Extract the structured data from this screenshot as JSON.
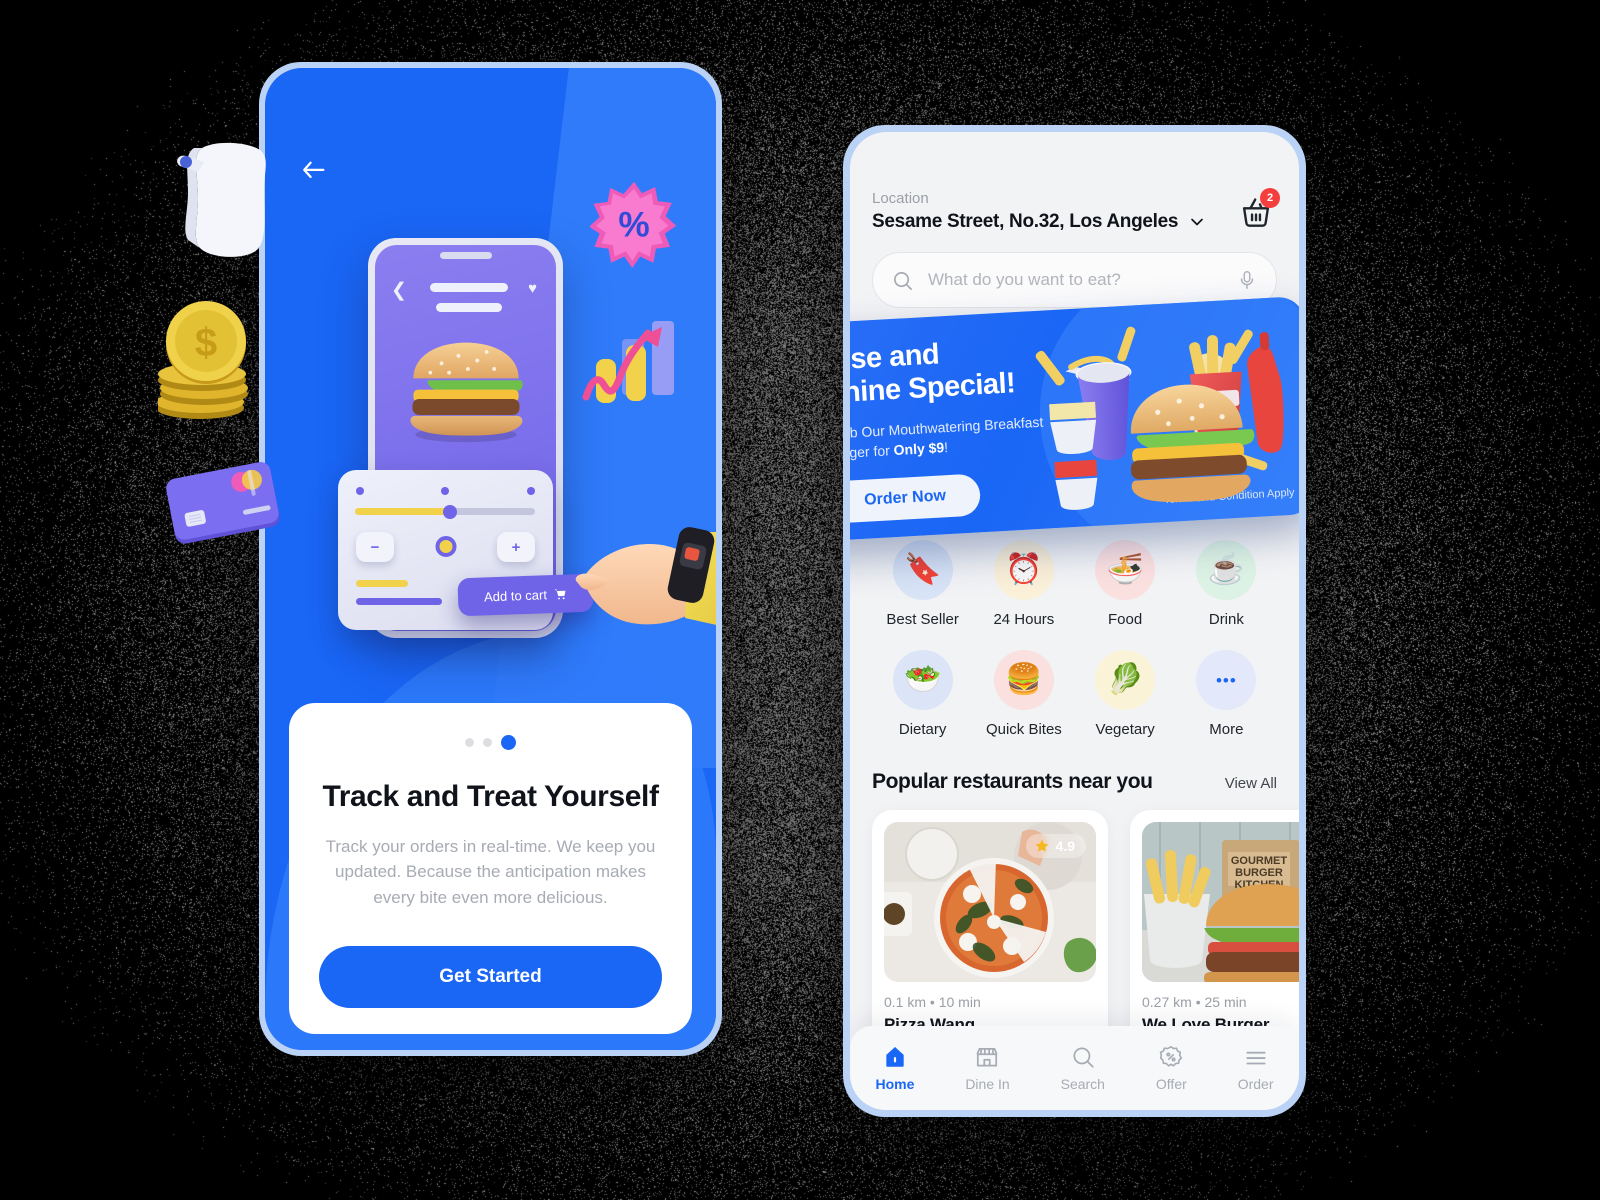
{
  "left_phone": {
    "back_icon": "back-arrow-icon",
    "illustration": {
      "add_to_cart_label": "Add to cart",
      "cart_icon": "shopping-cart-icon",
      "heart_icon": "heart-icon",
      "chevron_icon": "chevron-left-icon",
      "minus_label": "−",
      "plus_label": "+",
      "burger_icon": "burger-3d-icon",
      "percent_icon": "percent-burst-icon",
      "chart_icon": "growth-chart-3d-icon",
      "receipt_icon": "receipt-3d-icon",
      "coins_icon": "gold-coins-3d-icon",
      "credit_card_icon": "credit-card-3d-icon"
    },
    "onboarding": {
      "dots_total": 3,
      "active_dot": 3,
      "title": "Track and Treat Yourself",
      "description": "Track your orders in real-time. We keep you updated. Because the anticipation makes every bite even more delicious.",
      "cta_label": "Get Started"
    }
  },
  "right_phone": {
    "header": {
      "location_label": "Location",
      "location_value": "Sesame Street, No.32, Los Angeles",
      "chevron_icon": "chevron-down-icon",
      "cart_icon": "shopping-basket-icon",
      "cart_count": "2"
    },
    "search": {
      "placeholder": "What do you want to eat?",
      "value": "",
      "search_icon": "search-icon",
      "mic_icon": "microphone-icon"
    },
    "promo": {
      "title_line1": "Rise and",
      "title_line2": "Shine Special!",
      "subtitle_prefix": "Grab Our Mouthwatering Breakfast Burger for ",
      "subtitle_bold": "Only $9",
      "subtitle_suffix": "!",
      "button_label": "Order Now",
      "terms": "*Terms and Condition Apply",
      "art_icon": "burger-combo-3d-icon"
    },
    "categories": [
      {
        "label": "Best Seller",
        "icon": "bookmark-star-icon",
        "glyph": "🔖",
        "bg": "#d9e4f7"
      },
      {
        "label": "24 Hours",
        "icon": "clock-24h-icon",
        "glyph": "⏰",
        "bg": "#fbf0d8"
      },
      {
        "label": "Food",
        "icon": "noodle-bowl-icon",
        "glyph": "🍜",
        "bg": "#fbe0e0"
      },
      {
        "label": "Drink",
        "icon": "coffee-cup-icon",
        "glyph": "☕",
        "bg": "#dcf2e4"
      },
      {
        "label": "Dietary",
        "icon": "salad-bowl-icon",
        "glyph": "🥗",
        "bg": "#dbe5f7"
      },
      {
        "label": "Quick Bites",
        "icon": "burger-icon",
        "glyph": "🍔",
        "bg": "#fbe0e0"
      },
      {
        "label": "Vegetary",
        "icon": "veggie-bowl-icon",
        "glyph": "🥬",
        "bg": "#fbf3d8"
      },
      {
        "label": "More",
        "icon": "more-dots-icon",
        "glyph": "•••",
        "bg": "#e3e9fb"
      }
    ],
    "popular": {
      "title": "Popular restaurants near you",
      "view_all_label": "View All",
      "restaurants": [
        {
          "name": "Pizza Wang",
          "distance": "0.1 km",
          "duration": "10 min",
          "separator": "•",
          "rating": "4.9",
          "star_icon": "star-icon",
          "image": "pizza-photo"
        },
        {
          "name": "We Love Burger",
          "distance": "0.27 km",
          "duration": "25 min",
          "separator": "•",
          "rating": "",
          "star_icon": "star-icon",
          "image": "burger-photo"
        }
      ]
    },
    "bottom_nav": [
      {
        "label": "Home",
        "icon": "home-icon",
        "active": true
      },
      {
        "label": "Dine In",
        "icon": "store-icon",
        "active": false
      },
      {
        "label": "Search",
        "icon": "search-icon",
        "active": false
      },
      {
        "label": "Offer",
        "icon": "discount-icon",
        "active": false
      },
      {
        "label": "Order",
        "icon": "list-icon",
        "active": false
      }
    ]
  },
  "colors": {
    "primary_blue": "#1a66f5",
    "light_blue": "#2f7bfa",
    "bezel": "#b9d2f5",
    "screen_bg": "#f2f3f5",
    "badge_red": "#f53f3f",
    "purple": "#6f63e8",
    "yellow": "#f2d24b",
    "text_dark": "#10131a",
    "text_muted": "#a7abb3"
  }
}
